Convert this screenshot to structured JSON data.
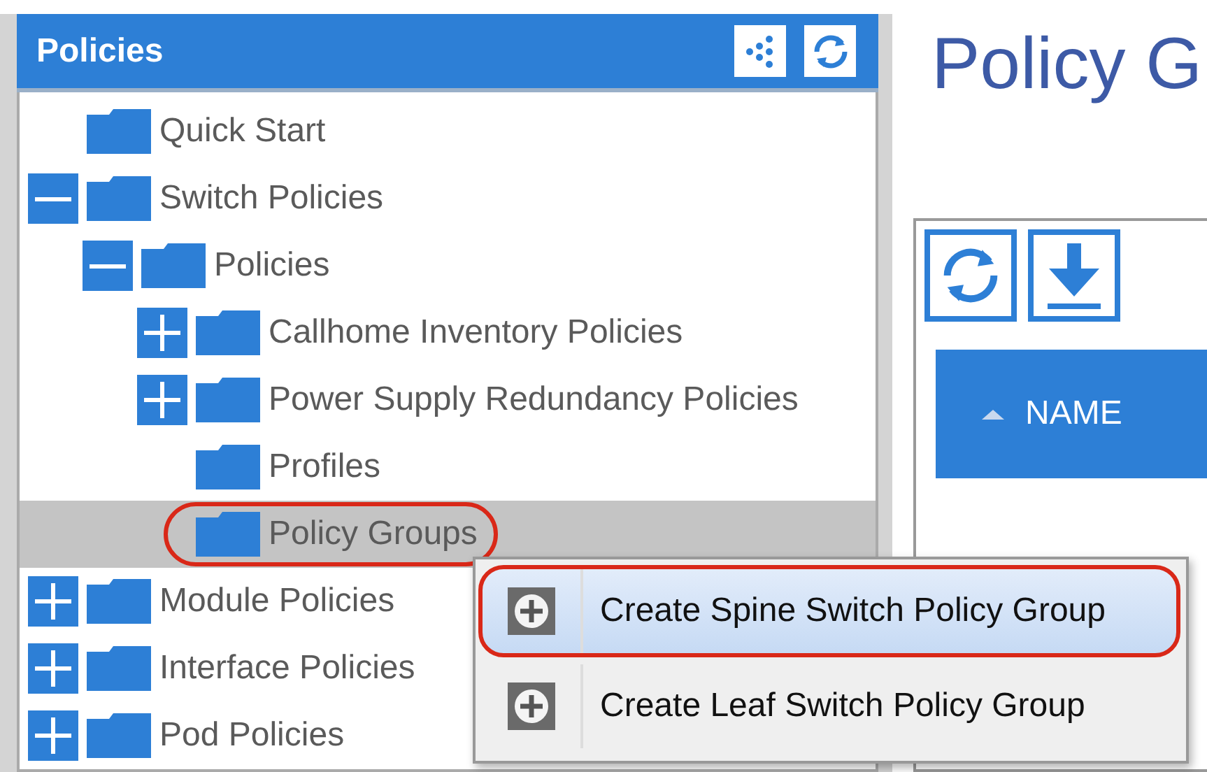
{
  "sidebar": {
    "title": "Policies",
    "tree": [
      {
        "label": "Quick Start",
        "kind": "leaf",
        "selected": false,
        "circled": false
      },
      {
        "label": "Switch Policies",
        "kind": "branch",
        "expanded": true,
        "selected": false,
        "circled": false,
        "children": [
          {
            "label": "Policies",
            "kind": "branch",
            "expanded": true,
            "selected": false,
            "circled": false,
            "children": [
              {
                "label": "Callhome Inventory Policies",
                "kind": "branch",
                "expanded": false,
                "selected": false,
                "circled": false
              },
              {
                "label": "Power Supply Redundancy Policies",
                "kind": "branch",
                "expanded": false,
                "selected": false,
                "circled": false
              },
              {
                "label": "Profiles",
                "kind": "leaf",
                "selected": false,
                "circled": false
              },
              {
                "label": "Policy Groups",
                "kind": "leaf",
                "selected": true,
                "circled": true
              }
            ]
          }
        ]
      },
      {
        "label": "Module Policies",
        "kind": "branch",
        "expanded": false,
        "selected": false,
        "circled": false
      },
      {
        "label": "Interface Policies",
        "kind": "branch",
        "expanded": false,
        "selected": false,
        "circled": false
      },
      {
        "label": "Pod Policies",
        "kind": "branch",
        "expanded": false,
        "selected": false,
        "circled": false
      }
    ]
  },
  "page": {
    "title": "Policy G",
    "table": {
      "columns": [
        "NAME"
      ]
    }
  },
  "context_menu": [
    {
      "label": "Create Spine Switch Policy Group",
      "selected": true,
      "circled": true
    },
    {
      "label": "Create Leaf Switch Policy Group",
      "selected": false,
      "circled": false
    }
  ]
}
